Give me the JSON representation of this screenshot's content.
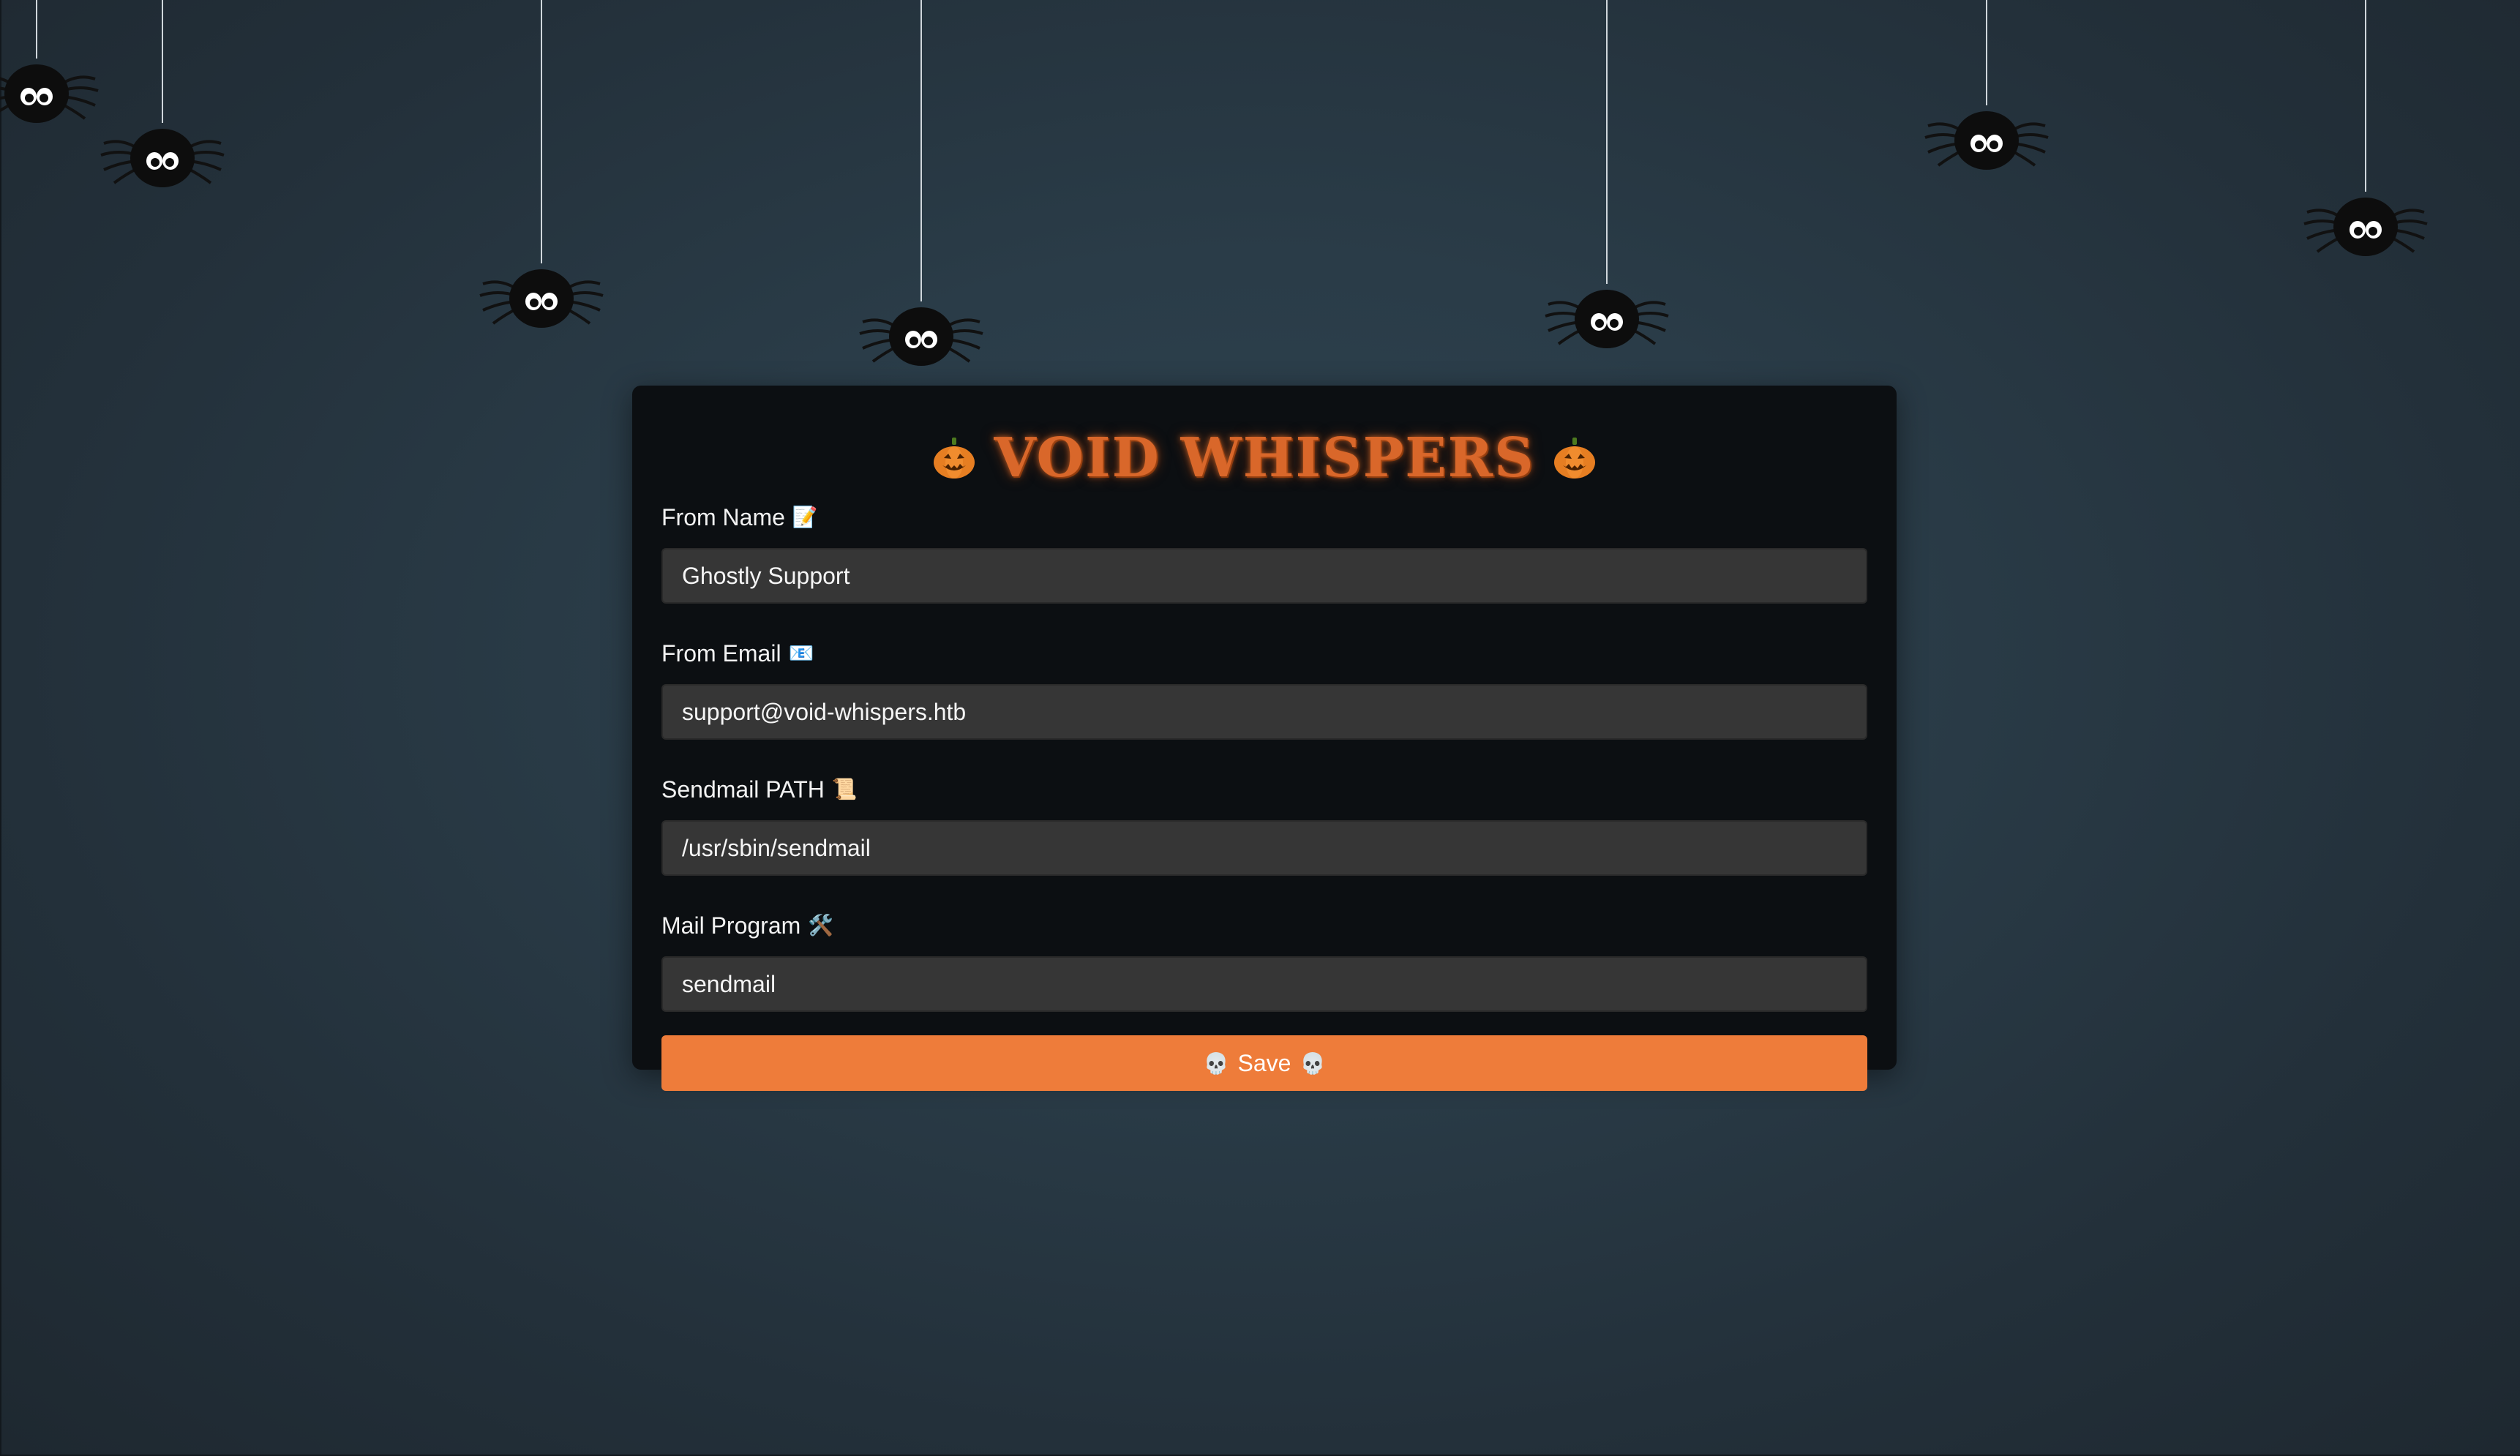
{
  "app": {
    "title": "VOID WHISPERS",
    "title_icon": "pumpkin-icon"
  },
  "form": {
    "fields": [
      {
        "label": "From Name",
        "icon": "📝",
        "value": "Ghostly Support"
      },
      {
        "label": "From Email",
        "icon": "📧",
        "value": "support@void-whispers.htb"
      },
      {
        "label": "Sendmail PATH",
        "icon": "📜",
        "value": "/usr/sbin/sendmail"
      },
      {
        "label": "Mail Program",
        "icon": "🛠️",
        "value": "sendmail"
      }
    ],
    "save_label": "Save",
    "save_icon": "💀"
  },
  "colors": {
    "accent": "#ee7c3a",
    "title": "#d9672a",
    "panel_bg": "#0c0f12",
    "input_bg": "#363636",
    "page_bg": "#2a3c48"
  }
}
